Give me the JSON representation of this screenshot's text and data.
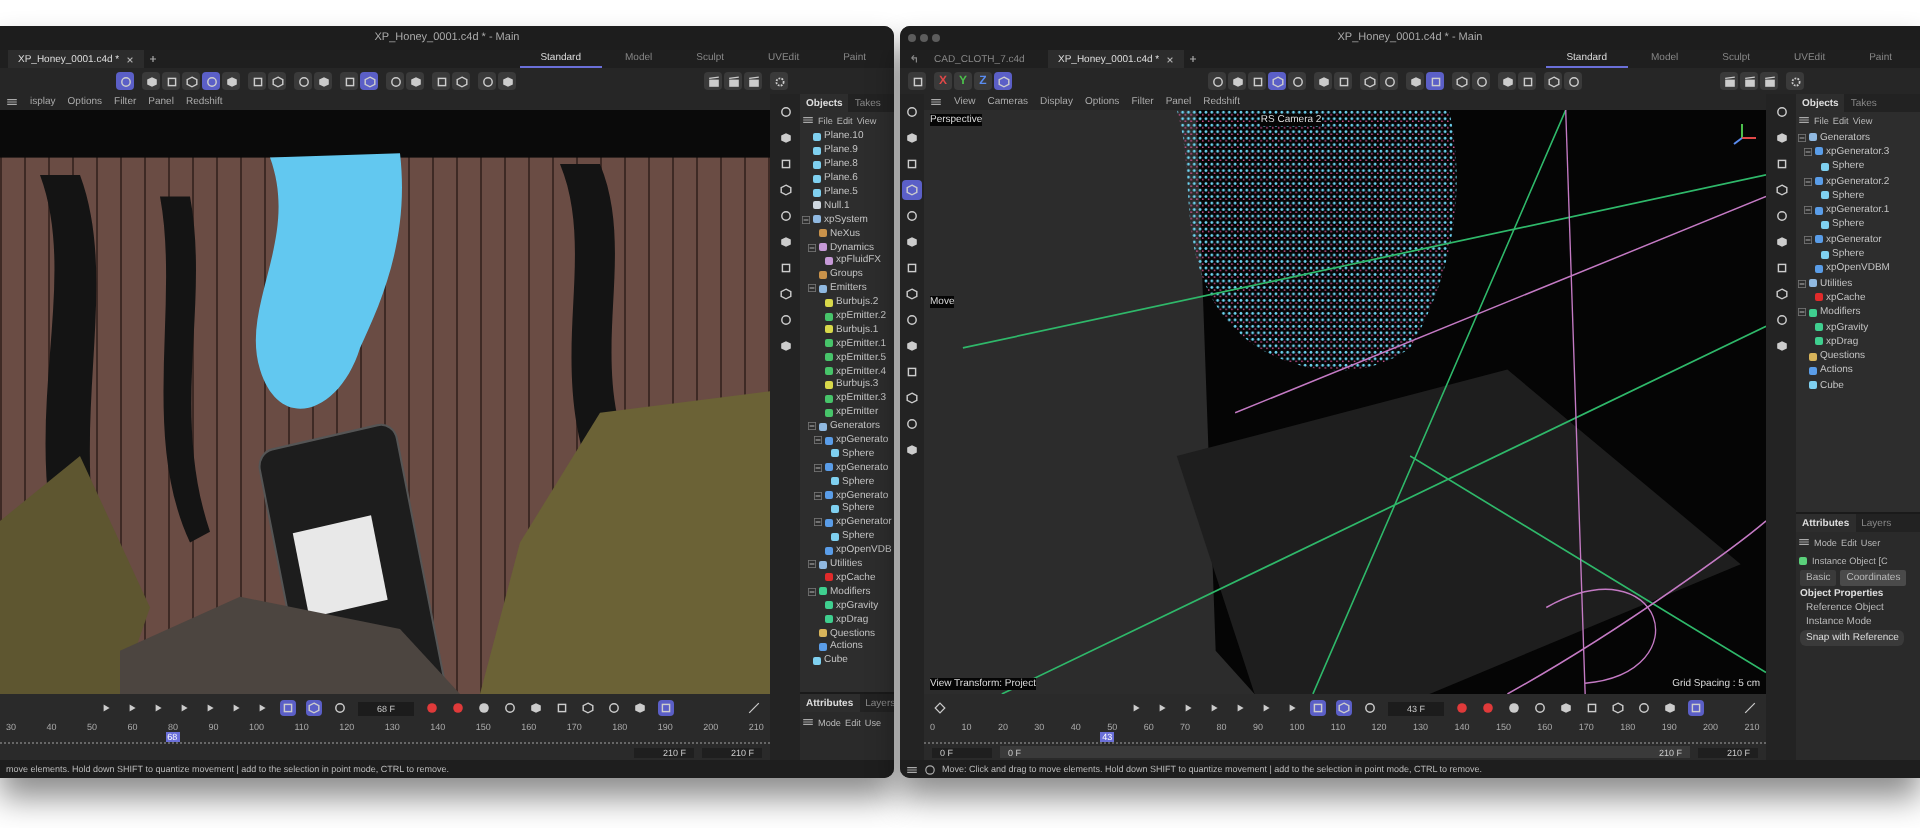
{
  "windows": [
    {
      "kind": "left",
      "title": "XP_Honey_0001.c4d * - Main",
      "file_tabs": [
        {
          "label": "XP_Honey_0001.c4d *",
          "selected": true
        }
      ],
      "layouts": [
        {
          "label": "Standard",
          "selected": true
        },
        {
          "label": "Model",
          "selected": false
        },
        {
          "label": "Sculpt",
          "selected": false
        },
        {
          "label": "UVEdit",
          "selected": false
        },
        {
          "label": "Paint",
          "selected": false
        }
      ],
      "toolbar": [
        [
          {
            "active": true
          }
        ],
        [
          {
            "active": false
          },
          {
            "active": false
          },
          {
            "active": false
          },
          {
            "active": true
          },
          {
            "active": false
          }
        ],
        [
          {
            "active": false
          },
          {
            "active": false
          }
        ],
        [
          {
            "active": false
          },
          {
            "active": false
          }
        ],
        [
          {
            "active": false
          },
          {
            "active": true
          }
        ],
        [
          {
            "active": false
          },
          {
            "active": false
          }
        ],
        [
          {
            "active": false
          },
          {
            "active": false
          }
        ],
        [
          {
            "active": false
          },
          {
            "active": false
          }
        ]
      ],
      "menu": [
        "isplay",
        "Options",
        "Filter",
        "Panel",
        "Redshift"
      ],
      "viewport": {
        "kind": "render"
      },
      "objects": {
        "tabs": [
          {
            "label": "Objects",
            "selected": true
          },
          {
            "label": "Takes",
            "selected": false
          }
        ],
        "menu": [
          "File",
          "Edit",
          "View"
        ],
        "tree": [
          {
            "label": "Plane.10",
            "kind": "plane"
          },
          {
            "label": "Plane.9",
            "kind": "plane"
          },
          {
            "label": "Plane.8",
            "kind": "plane"
          },
          {
            "label": "Plane.6",
            "kind": "plane"
          },
          {
            "label": "Plane.5",
            "kind": "plane"
          },
          {
            "label": "Null.1",
            "kind": "null"
          },
          {
            "label": "xpSystem",
            "kind": "system",
            "expanded": true,
            "children": [
              {
                "label": "NeXus",
                "kind": "nexus"
              },
              {
                "label": "Dynamics",
                "kind": "dynamics",
                "expanded": true,
                "children": [
                  {
                    "label": "xpFluidFX",
                    "kind": "fluid"
                  }
                ]
              },
              {
                "label": "Groups",
                "kind": "nexus"
              },
              {
                "label": "Emitters",
                "kind": "folder",
                "expanded": true,
                "children": [
                  {
                    "label": "Burbujs.2",
                    "kind": "burbujs"
                  },
                  {
                    "label": "xpEmitter.2",
                    "kind": "emitter"
                  },
                  {
                    "label": "Burbujs.1",
                    "kind": "burbujs"
                  },
                  {
                    "label": "xpEmitter.1",
                    "kind": "emitter"
                  },
                  {
                    "label": "xpEmitter.5",
                    "kind": "emitter"
                  },
                  {
                    "label": "xpEmitter.4",
                    "kind": "emitter"
                  },
                  {
                    "label": "Burbujs.3",
                    "kind": "burbujs"
                  },
                  {
                    "label": "xpEmitter.3",
                    "kind": "emitter"
                  },
                  {
                    "label": "xpEmitter",
                    "kind": "emitter"
                  }
                ]
              },
              {
                "label": "Generators",
                "kind": "folder",
                "expanded": true,
                "children": [
                  {
                    "label": "xpGenerato",
                    "kind": "generator",
                    "expanded": true,
                    "children": [
                      {
                        "label": "Sphere",
                        "kind": "sphere"
                      }
                    ]
                  },
                  {
                    "label": "xpGenerato",
                    "kind": "generator",
                    "expanded": true,
                    "children": [
                      {
                        "label": "Sphere",
                        "kind": "sphere"
                      }
                    ]
                  },
                  {
                    "label": "xpGenerato",
                    "kind": "generator",
                    "expanded": true,
                    "children": [
                      {
                        "label": "Sphere",
                        "kind": "sphere"
                      }
                    ]
                  },
                  {
                    "label": "xpGenerator",
                    "kind": "generator",
                    "expanded": true,
                    "children": [
                      {
                        "label": "Sphere",
                        "kind": "sphere"
                      }
                    ]
                  },
                  {
                    "label": "xpOpenVDB",
                    "kind": "generator"
                  }
                ]
              },
              {
                "label": "Utilities",
                "kind": "folder",
                "expanded": true,
                "children": [
                  {
                    "label": "xpCache",
                    "kind": "cache"
                  }
                ]
              },
              {
                "label": "Modifiers",
                "kind": "modifierfolder",
                "expanded": true,
                "children": [
                  {
                    "label": "xpGravity",
                    "kind": "modifier"
                  },
                  {
                    "label": "xpDrag",
                    "kind": "modifier"
                  }
                ]
              },
              {
                "label": "Questions",
                "kind": "question"
              },
              {
                "label": "Actions",
                "kind": "action"
              }
            ]
          },
          {
            "label": "Cube",
            "kind": "sphere"
          }
        ]
      },
      "attributes": {
        "tabs": [
          {
            "label": "Attributes",
            "selected": true
          },
          {
            "label": "Layers",
            "selected": false
          }
        ],
        "menu": [
          "Mode",
          "Edit",
          "Use"
        ]
      },
      "timeline": {
        "frame": "68 F",
        "transport": [
          {
            "active": false
          },
          {
            "active": false
          },
          {
            "active": false
          },
          {
            "active": false
          },
          {
            "active": false
          },
          {
            "active": false
          },
          {
            "active": false
          }
        ],
        "modes": [
          {
            "active": true
          },
          {
            "active": true
          },
          {
            "active": false
          }
        ],
        "record": [
          {
            "active": true
          },
          {
            "active": true
          },
          {
            "active": false
          }
        ],
        "extras": [
          {
            "active": false
          },
          {
            "active": false
          },
          {
            "active": false
          },
          {
            "active": false
          },
          {
            "active": false
          },
          {
            "active": false
          },
          {
            "active": true
          }
        ],
        "ticks": [
          "30",
          "40",
          "50",
          "60",
          "80",
          "90",
          "100",
          "110",
          "120",
          "130",
          "140",
          "150",
          "160",
          "170",
          "180",
          "190",
          "200",
          "210"
        ],
        "playhead": {
          "label": "68",
          "level": 0.21
        },
        "range_end": [
          "210 F",
          "210 F"
        ]
      },
      "status": "move elements. Hold down SHIFT to quantize movement | add to the selection in point mode, CTRL to remove."
    },
    {
      "kind": "right",
      "title": "XP_Honey_0001.c4d * - Main",
      "file_tabs": [
        {
          "label": "CAD_CLOTH_7.c4d",
          "selected": false
        },
        {
          "label": "XP_Honey_0001.c4d *",
          "selected": true
        }
      ],
      "layouts": [
        {
          "label": "Standard",
          "selected": true
        },
        {
          "label": "Model",
          "selected": false
        },
        {
          "label": "Sculpt",
          "selected": false
        },
        {
          "label": "UVEdit",
          "selected": false
        },
        {
          "label": "Paint",
          "selected": false
        }
      ],
      "axes": [
        {
          "label": "X",
          "color": "#e04848"
        },
        {
          "label": "Y",
          "color": "#4cc04c"
        },
        {
          "label": "Z",
          "color": "#5a8cf0"
        }
      ],
      "toolbar": [
        [
          {
            "active": false
          },
          {
            "active": false
          },
          {
            "active": false
          },
          {
            "active": true
          },
          {
            "active": false
          }
        ],
        [
          {
            "active": false
          },
          {
            "active": false
          }
        ],
        [
          {
            "active": false
          },
          {
            "active": false
          }
        ],
        [
          {
            "active": false
          },
          {
            "active": true
          }
        ],
        [
          {
            "active": false
          },
          {
            "active": false
          }
        ],
        [
          {
            "active": false
          },
          {
            "active": false
          }
        ],
        [
          {
            "active": false
          },
          {
            "active": false
          }
        ]
      ],
      "menu": [
        "View",
        "Cameras",
        "Display",
        "Options",
        "Filter",
        "Panel",
        "Redshift"
      ],
      "left_tools": [
        {
          "selected": false
        },
        {
          "selected": false
        },
        {
          "selected": false
        },
        {
          "selected": true
        },
        {
          "selected": false
        },
        {
          "selected": false
        },
        {
          "selected": false
        },
        {
          "selected": false
        },
        {
          "selected": false
        },
        {
          "selected": false
        },
        {
          "selected": false
        },
        {
          "selected": false
        },
        {
          "selected": false
        },
        {
          "selected": false
        }
      ],
      "viewport": {
        "kind": "wireframe",
        "view_name": "Perspective",
        "camera": "RS Camera 2",
        "tool": "Move",
        "transform": "View Transform: Project",
        "grid": "Grid Spacing : 5 cm"
      },
      "objects": {
        "tabs": [
          {
            "label": "Objects",
            "selected": true
          },
          {
            "label": "Takes",
            "selected": false
          }
        ],
        "menu": [
          "File",
          "Edit",
          "View"
        ],
        "tree": [
          {
            "label": "Generators",
            "kind": "folder",
            "expanded": true,
            "children": [
              {
                "label": "xpGenerator.3",
                "kind": "generator",
                "expanded": true,
                "children": [
                  {
                    "label": "Sphere",
                    "kind": "sphere"
                  }
                ]
              },
              {
                "label": "xpGenerator.2",
                "kind": "generator",
                "expanded": true,
                "children": [
                  {
                    "label": "Sphere",
                    "kind": "sphere"
                  }
                ]
              },
              {
                "label": "xpGenerator.1",
                "kind": "generator",
                "expanded": true,
                "children": [
                  {
                    "label": "Sphere",
                    "kind": "sphere"
                  }
                ]
              },
              {
                "label": "xpGenerator",
                "kind": "generator",
                "expanded": true,
                "children": [
                  {
                    "label": "Sphere",
                    "kind": "sphere"
                  }
                ]
              },
              {
                "label": "xpOpenVDBM",
                "kind": "generator"
              }
            ]
          },
          {
            "label": "Utilities",
            "kind": "folder",
            "expanded": true,
            "children": [
              {
                "label": "xpCache",
                "kind": "cache"
              }
            ]
          },
          {
            "label": "Modifiers",
            "kind": "modifierfolder",
            "expanded": true,
            "children": [
              {
                "label": "xpGravity",
                "kind": "modifier"
              },
              {
                "label": "xpDrag",
                "kind": "modifier"
              }
            ]
          },
          {
            "label": "Questions",
            "kind": "question"
          },
          {
            "label": "Actions",
            "kind": "action"
          },
          {
            "label": "Cube",
            "kind": "sphere"
          }
        ]
      },
      "attributes": {
        "tabs": [
          {
            "label": "Attributes",
            "selected": true
          },
          {
            "label": "Layers",
            "selected": false
          }
        ],
        "menu": [
          "Mode",
          "Edit",
          "User"
        ],
        "object": "Instance Object [C",
        "subtabs": [
          {
            "label": "Basic",
            "selected": false
          },
          {
            "label": "Coordinates",
            "selected": true
          }
        ],
        "section": "Object Properties",
        "fields": [
          "Reference Object",
          "Instance Mode"
        ],
        "button": "Snap with Reference"
      },
      "timeline": {
        "frame": "43 F",
        "transport": [
          {
            "active": false
          },
          {
            "active": false
          },
          {
            "active": false
          },
          {
            "active": false
          },
          {
            "active": false
          },
          {
            "active": false
          },
          {
            "active": false
          }
        ],
        "modes": [
          {
            "active": true
          },
          {
            "active": true
          },
          {
            "active": false
          }
        ],
        "record": [
          {
            "active": true
          },
          {
            "active": true
          },
          {
            "active": false
          }
        ],
        "extras": [
          {
            "active": false
          },
          {
            "active": false
          },
          {
            "active": false
          },
          {
            "active": false
          },
          {
            "active": false
          },
          {
            "active": false
          },
          {
            "active": true
          }
        ],
        "ticks": [
          "0",
          "10",
          "20",
          "30",
          "40",
          "50",
          "60",
          "70",
          "80",
          "90",
          "100",
          "110",
          "120",
          "130",
          "140",
          "150",
          "160",
          "170",
          "180",
          "190",
          "200",
          "210"
        ],
        "playhead": {
          "label": "43",
          "level": 0.205
        },
        "range_start": [
          "0 F",
          "0 F"
        ],
        "range_end": [
          "210 F",
          "210 F"
        ]
      },
      "status": "Move: Click and drag to move elements. Hold down SHIFT to quantize movement | add to the selection in point mode, CTRL to remove."
    }
  ]
}
